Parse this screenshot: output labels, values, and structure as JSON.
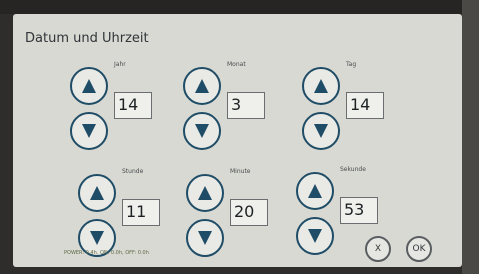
{
  "title": "Datum und Uhrzeit",
  "fields": [
    {
      "label": "Jahr",
      "value": "14"
    },
    {
      "label": "Monat",
      "value": "3"
    },
    {
      "label": "Tag",
      "value": "14"
    },
    {
      "label": "Stunde",
      "value": "11"
    },
    {
      "label": "Minute",
      "value": "20"
    },
    {
      "label": "Sekunde",
      "value": "53"
    }
  ],
  "status": "POWER: 0.4h, ON: 0.0h, OFF: 0.0h",
  "actions": {
    "cancel": "X",
    "ok": "OK"
  },
  "icons": {
    "up": "arrow-up-icon",
    "down": "arrow-down-icon"
  },
  "colors": {
    "accent": "#1f4c66",
    "screen": "#d8d9d3"
  }
}
